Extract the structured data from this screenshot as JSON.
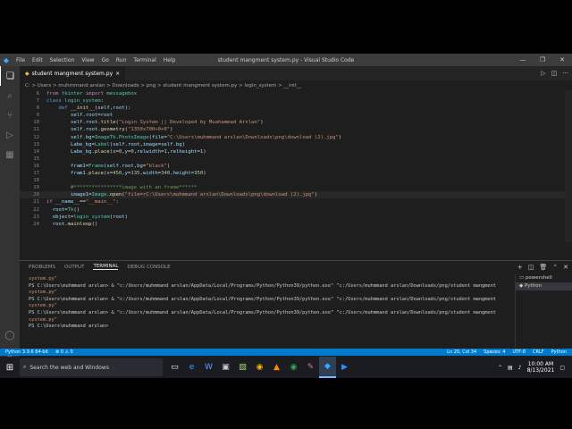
{
  "window": {
    "title": "student mangment system.py - Visual Studio Code",
    "menu": [
      "File",
      "Edit",
      "Selection",
      "View",
      "Go",
      "Run",
      "Terminal",
      "Help"
    ]
  },
  "tab": {
    "label": "student mangment system.py",
    "close": "×"
  },
  "breadcrumb": "C: > Users > muhmmand arslan > Downloads > png > student mangment system.py > login_system > __init__",
  "editor": {
    "lines": [
      {
        "n": "6",
        "html": "<span class='kw'>from</span> <span class='cls'>tkinter</span> <span class='kw'>import</span> <span class='cls'>messagebox</span>"
      },
      {
        "n": "7",
        "html": "<span class='kb'>class</span> <span class='cls'>login_system</span>:"
      },
      {
        "n": "8",
        "html": "    <span class='kb'>def</span> <span class='fn'>__init__</span>(<span class='var'>self</span>,<span class='var'>root</span>):"
      },
      {
        "n": "9",
        "html": "        <span class='var'>self</span>.<span class='var'>root</span>=<span class='var'>root</span>"
      },
      {
        "n": "10",
        "html": "        <span class='var'>self</span>.<span class='var'>root</span>.<span class='fn'>title</span>(<span class='str'>\"Login System || Developed by Muahammad Arslan\"</span>)"
      },
      {
        "n": "11",
        "html": "        <span class='var'>self</span>.<span class='var'>root</span>.<span class='fn'>geometry</span>(<span class='str'>\"1350x700+0+0\"</span>)"
      },
      {
        "n": "12",
        "html": "        <span class='var'>self</span>.<span class='var'>bg</span>=<span class='cls'>ImageTk</span>.<span class='cls'>PhotoImage</span>(<span class='var'>file</span>=<span class='str'>\"C:\\Users\\muhmmand arslan\\Downloads\\png\\download (2).jpg\"</span>)"
      },
      {
        "n": "13",
        "html": "        <span class='var'>Labe_bg</span>=<span class='cls'>Label</span>(<span class='var'>self</span>.<span class='var'>root</span>,<span class='var'>image</span>=<span class='var'>self</span>.<span class='var'>bg</span>)"
      },
      {
        "n": "14",
        "html": "        <span class='var'>Labe_bg</span>.<span class='fn'>place</span>(<span class='var'>x</span>=<span class='num'>0</span>,<span class='var'>y</span>=<span class='num'>0</span>,<span class='var'>relwidth</span>=<span class='num'>1</span>,<span class='var'>relheight</span>=<span class='num'>1</span>)"
      },
      {
        "n": "15",
        "html": ""
      },
      {
        "n": "16",
        "html": "        <span class='var'>fram1</span>=<span class='cls'>Frame</span>(<span class='var'>self</span>.<span class='var'>root</span>,<span class='var'>bg</span>=<span class='str'>\"black\"</span>)"
      },
      {
        "n": "17",
        "html": "        <span class='var'>fram1</span>.<span class='fn'>place</span>(<span class='var'>x</span>=<span class='num'>450</span>,<span class='var'>y</span>=<span class='num'>135</span>,<span class='var'>width</span>=<span class='num'>340</span>,<span class='var'>height</span>=<span class='num'>350</span>)"
      },
      {
        "n": "18",
        "html": ""
      },
      {
        "n": "19",
        "html": "        <span class='cm'>#****************image with an frame******</span>"
      },
      {
        "n": "20",
        "html": "        <span class='var'>image1</span>=<span class='cls'>Image</span>.<span class='fn'>open</span>(<span class='str'>\"file=rC:\\Users\\muhmmand arslan\\Downloads\\png\\download (2).jpg\"</span>)"
      },
      {
        "n": "21",
        "html": "<span class='kw'>if</span> <span class='var'>__name__</span>==<span class='str'>\"__main__\"</span>:"
      },
      {
        "n": "22",
        "html": "  <span class='var'>root</span>=<span class='cls'>Tk</span>()"
      },
      {
        "n": "23",
        "html": "  <span class='var'>object</span>=<span class='cls'>login_system</span>(<span class='var'>root</span>)"
      },
      {
        "n": "24",
        "html": "  <span class='var'>root</span>.<span class='fn'>mainloop</span>()"
      }
    ],
    "current_line": "20"
  },
  "panel": {
    "tabs": [
      "PROBLEMS",
      "OUTPUT",
      "TERMINAL",
      "DEBUG CONSOLE"
    ],
    "active_tab": "TERMINAL",
    "terminal_lines": [
      {
        "t": "system.py\"",
        "cls": "cont"
      },
      {
        "t": "PS C:\\Users\\muhmmand arslan> & \"c:/Users/muhmmand arslan/AppData/Local/Programs/Python/Python39/python.exe\" \"c:/Users/muhmmand arslan/Downloads/png/student mangment",
        "cls": ""
      },
      {
        "t": "system.py\"",
        "cls": "cont"
      },
      {
        "t": "PS C:\\Users\\muhmmand arslan> & \"c:/Users/muhmmand arslan/AppData/Local/Programs/Python/Python39/python.exe\" \"c:/Users/muhmmand arslan/Downloads/png/student mangment",
        "cls": ""
      },
      {
        "t": "system.py\"",
        "cls": "cont"
      },
      {
        "t": "PS C:\\Users\\muhmmand arslan> & \"c:/Users/muhmmand arslan/AppData/Local/Programs/Python/Python39/python.exe\" \"c:/Users/muhmmand arslan/Downloads/png/student mangment",
        "cls": ""
      },
      {
        "t": "system.py\"",
        "cls": "cont"
      },
      {
        "t": "PS C:\\Users\\muhmmand arslan> ",
        "cls": ""
      }
    ],
    "terminal_list": [
      "powershell",
      "Python"
    ]
  },
  "status": {
    "left": [
      "Python 3.9.6 64-bit",
      "⊗ 0 ⚠ 0"
    ],
    "right": [
      "Ln 20, Col 34",
      "Spaces: 4",
      "UTF-8",
      "CRLF",
      "Python"
    ]
  },
  "taskbar": {
    "search_placeholder": "Search the web and Windows",
    "time": "10:00 AM",
    "date": "8/13/2021"
  }
}
